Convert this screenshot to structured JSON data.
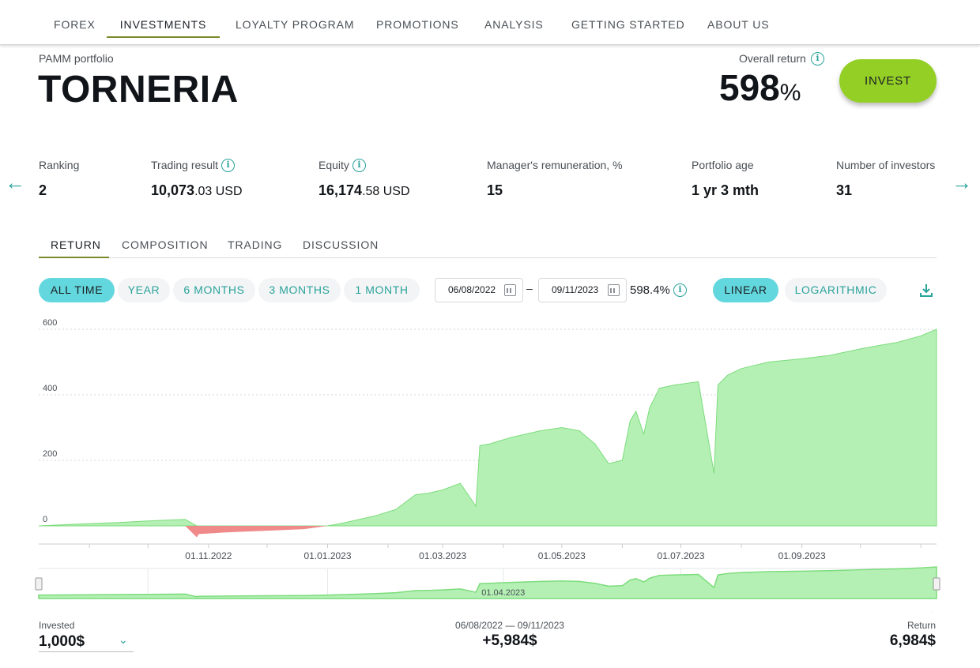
{
  "nav": {
    "items": [
      {
        "label": "FOREX",
        "active": false
      },
      {
        "label": "INVESTMENTS",
        "active": true
      },
      {
        "label": "LOYALTY PROGRAM",
        "active": false
      },
      {
        "label": "PROMOTIONS",
        "active": false
      },
      {
        "label": "ANALYSIS",
        "active": false
      },
      {
        "label": "GETTING STARTED",
        "active": false
      },
      {
        "label": "ABOUT US",
        "active": false
      }
    ]
  },
  "header": {
    "subtitle": "PAMM portfolio",
    "title": "TORNERIA",
    "overall_label": "Overall return",
    "overall_value": "598",
    "overall_unit": "%",
    "invest_label": "INVEST"
  },
  "stats": [
    {
      "label": "Ranking",
      "value": "2",
      "decimal": "",
      "info": false
    },
    {
      "label": "Trading result",
      "value": "10,073",
      "decimal": ".03 USD",
      "info": true
    },
    {
      "label": "Equity",
      "value": "16,174",
      "decimal": ".58 USD",
      "info": true
    },
    {
      "label": "Manager's remuneration, %",
      "value": "15",
      "decimal": "",
      "info": false
    },
    {
      "label": "Portfolio age",
      "value": "1 yr 3 mth",
      "decimal": "",
      "info": false
    },
    {
      "label": "Number of investors",
      "value": "31",
      "decimal": "",
      "info": false
    }
  ],
  "tabs": [
    {
      "label": "RETURN",
      "active": true
    },
    {
      "label": "COMPOSITION",
      "active": false
    },
    {
      "label": "TRADING",
      "active": false
    },
    {
      "label": "DISCUSSION",
      "active": false
    }
  ],
  "periods": [
    {
      "label": "ALL TIME",
      "active": true
    },
    {
      "label": "YEAR",
      "active": false
    },
    {
      "label": "6 MONTHS",
      "active": false
    },
    {
      "label": "3 MONTHS",
      "active": false
    },
    {
      "label": "1 MONTH",
      "active": false
    }
  ],
  "date_range": {
    "from": "06/08/2022",
    "dash": "–",
    "to": "09/11/2023",
    "return": "598.4%"
  },
  "scales": [
    {
      "label": "LINEAR",
      "active": true
    },
    {
      "label": "LOGARITHMIC",
      "active": false
    }
  ],
  "colors": {
    "accent": "#2aa39b",
    "pill_active": "#62d7dd",
    "invest_button": "#94cf26",
    "positive_area": "#b4f0b4",
    "positive_line": "#7cdc7c",
    "negative_area": "#f08a8a"
  },
  "chart_data": {
    "type": "area",
    "ylim": [
      -40,
      600
    ],
    "y_ticks": [
      0,
      200,
      400,
      600
    ],
    "x_ticks": [
      "01.11.2022",
      "01.01.2023",
      "01.03.2023",
      "01.05.2023",
      "01.07.2023",
      "01.09.2023"
    ],
    "navigator_label": "01.04.2023",
    "x_range": [
      "2022-08-06",
      "2023-11-09"
    ],
    "series": [
      {
        "x": [
          "2022-08-06",
          "2022-08-25",
          "2022-09-15",
          "2022-10-01",
          "2022-10-20",
          "2022-10-26",
          "2022-10-27",
          "2022-11-10",
          "2022-11-30",
          "2022-12-20",
          "2023-01-01",
          "2023-01-10",
          "2023-01-25",
          "2023-02-05",
          "2023-02-15",
          "2023-02-22",
          "2023-03-01",
          "2023-03-10",
          "2023-03-18",
          "2023-03-20",
          "2023-03-25",
          "2023-04-05",
          "2023-04-20",
          "2023-05-01",
          "2023-05-10",
          "2023-05-18",
          "2023-05-25",
          "2023-06-01",
          "2023-06-05",
          "2023-06-08",
          "2023-06-12",
          "2023-06-15",
          "2023-06-20",
          "2023-06-28",
          "2023-07-10",
          "2023-07-18",
          "2023-07-20",
          "2023-07-25",
          "2023-08-01",
          "2023-08-15",
          "2023-09-01",
          "2023-09-15",
          "2023-10-01",
          "2023-10-10",
          "2023-10-20",
          "2023-11-01",
          "2023-11-09"
        ],
        "y": [
          0,
          5,
          10,
          15,
          20,
          -35,
          -25,
          -20,
          -15,
          -10,
          0,
          10,
          30,
          50,
          95,
          100,
          110,
          130,
          60,
          245,
          250,
          270,
          290,
          300,
          290,
          250,
          190,
          200,
          320,
          350,
          280,
          360,
          420,
          430,
          440,
          160,
          430,
          460,
          480,
          500,
          510,
          520,
          540,
          550,
          560,
          580,
          600
        ]
      }
    ]
  },
  "footer": {
    "invested_label": "Invested",
    "invested_value": "1,000$",
    "range": "06/08/2022 — 09/11/2023",
    "profit": "+5,984$",
    "return_label": "Return",
    "return_value": "6,984$"
  }
}
